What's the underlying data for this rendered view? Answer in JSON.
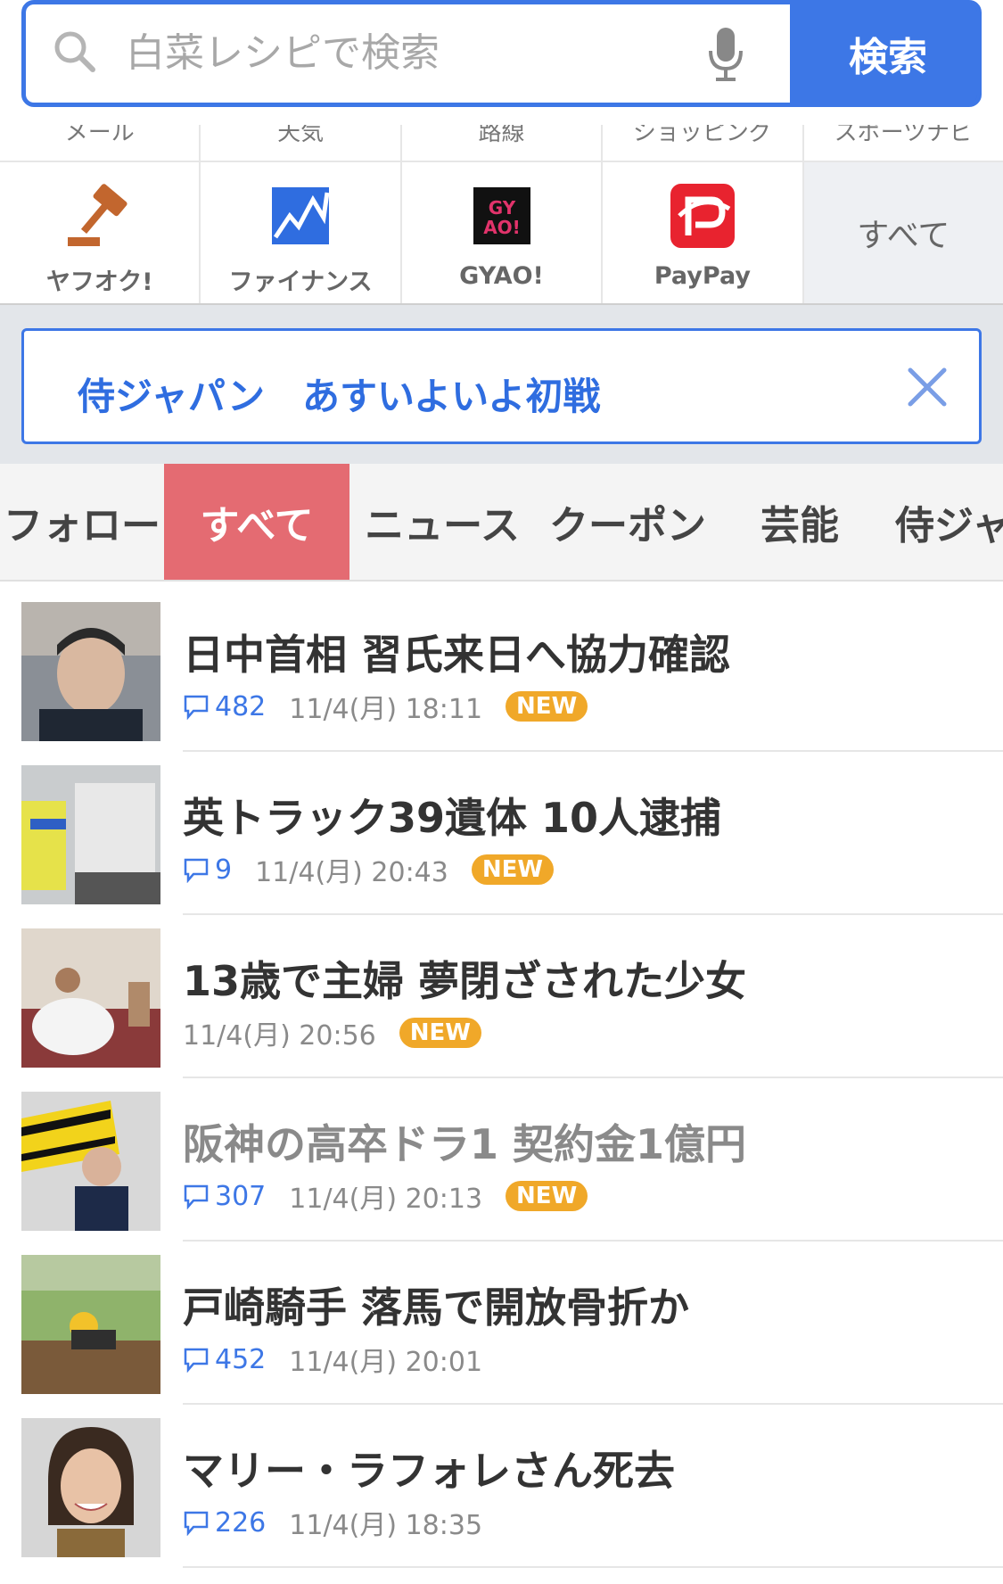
{
  "search": {
    "placeholder": "白菜レシピで検索",
    "button_label": "検索"
  },
  "services_top": [
    "メール",
    "天気",
    "路線",
    "ショッピング",
    "スポーツナビ"
  ],
  "services": [
    {
      "label": "ヤフオク!",
      "icon": "gavel-icon"
    },
    {
      "label": "ファイナンス",
      "icon": "chart-icon"
    },
    {
      "label": "GYAO!",
      "icon": "gyao-icon"
    },
    {
      "label": "PayPay",
      "icon": "paypay-icon"
    }
  ],
  "services_all_label": "すべて",
  "alert": {
    "text": "侍ジャパン　あすいよいよ初戦"
  },
  "tabs": [
    "フォロー",
    "すべて",
    "ニュース",
    "クーポン",
    "芸能",
    "侍ジャ"
  ],
  "active_tab": "すべて",
  "news": [
    {
      "title": "日中首相 習氏来日へ協力確認",
      "comments": "482",
      "time": "11/4(月) 18:11",
      "badge": "NEW"
    },
    {
      "title": "英トラック39遺体 10人逮捕",
      "comments": "9",
      "time": "11/4(月) 20:43",
      "badge": "NEW"
    },
    {
      "title": "13歳で主婦 夢閉ざされた少女",
      "comments": "",
      "time": "11/4(月) 20:56",
      "badge": "NEW"
    },
    {
      "title": "阪神の高卒ドラ1 契約金1億円",
      "comments": "307",
      "time": "11/4(月) 20:13",
      "badge": "NEW"
    },
    {
      "title": "戸崎騎手 落馬で開放骨折か",
      "comments": "452",
      "time": "11/4(月) 20:01",
      "badge": ""
    },
    {
      "title": "マリー・ラフォレさん死去",
      "comments": "226",
      "time": "11/4(月) 18:35",
      "badge": ""
    }
  ],
  "colors": {
    "accent": "#3d77e6",
    "active_tab": "#e46b72",
    "new_badge": "#f0a829"
  }
}
